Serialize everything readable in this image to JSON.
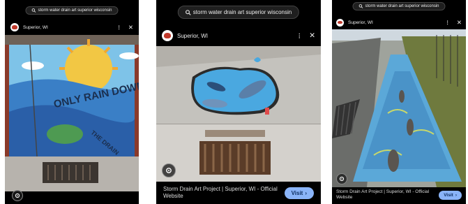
{
  "search": {
    "query_small": "storm water drain art superior wisconsin",
    "query_medium": "storm water drain art superior wisconsin",
    "query_right": "storm water drain art superior wisconsin"
  },
  "results": [
    {
      "source": "Superior, WI",
      "mural_text_1": "ONLY RAIN DOWN",
      "mural_text_2": "THE DRAIN"
    },
    {
      "source": "Superior, WI",
      "caption": "Storm Drain Art Project | Superior, WI - Official Website",
      "visit_label": "Visit"
    },
    {
      "source": "Superior, WI",
      "caption": "Storm Drain Art Project | Superior, WI - Official Website",
      "visit_label": "Visit"
    }
  ],
  "icons": {
    "search": "search-icon",
    "more": "more-vert-icon",
    "close": "close-icon",
    "lens": "lens-icon",
    "chevron": "chevron-right-icon"
  },
  "colors": {
    "accent": "#8ab4f8",
    "panel_bg": "#000000"
  }
}
